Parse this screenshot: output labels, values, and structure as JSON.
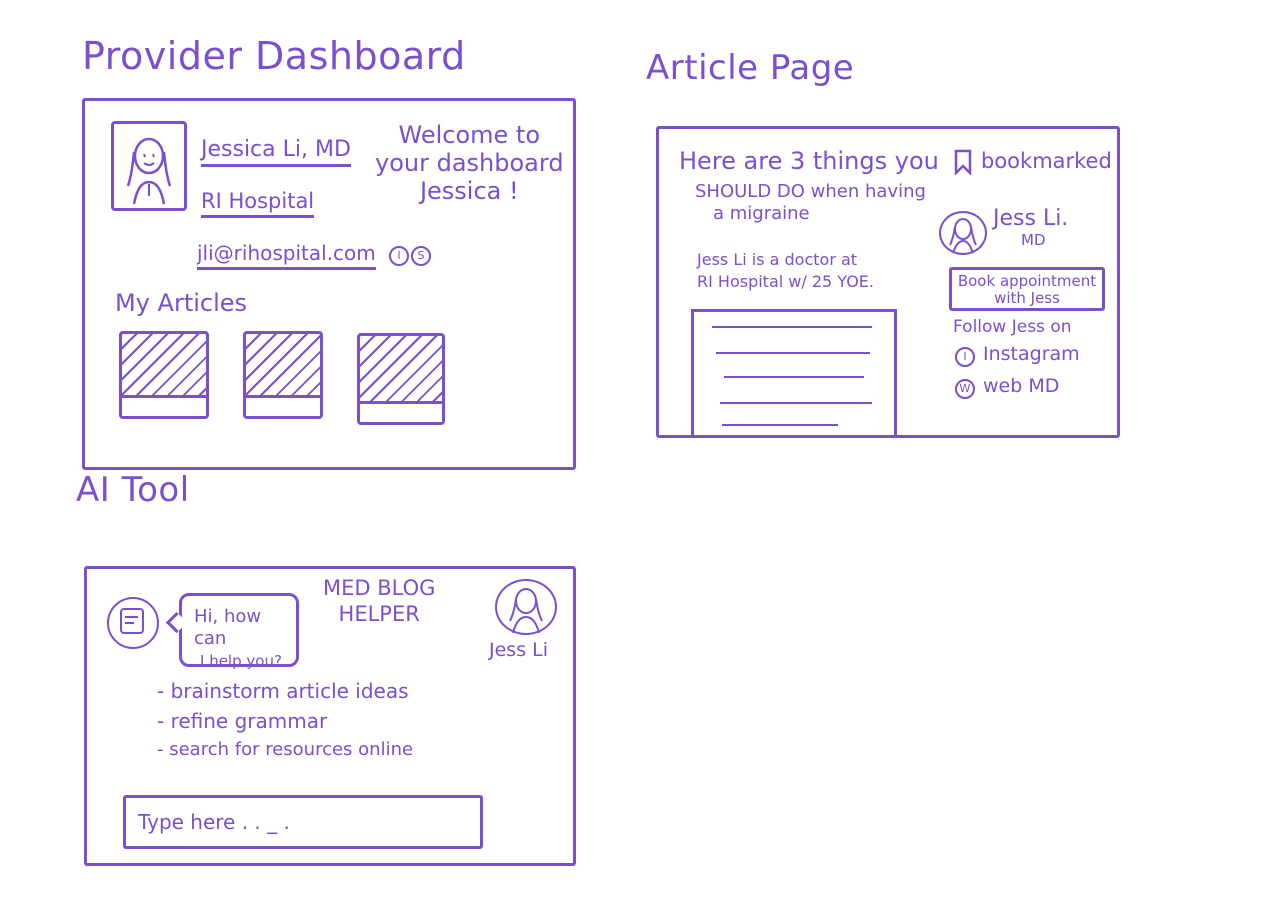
{
  "titles": {
    "provider_dashboard": "Provider Dashboard",
    "article_page": "Article Page",
    "ai_tool": "AI Tool"
  },
  "dashboard": {
    "name": "Jessica Li, MD",
    "hospital": "RI Hospital",
    "email": "jli@rihospital.com",
    "social_icons": [
      "I",
      "S"
    ],
    "welcome_line1": "Welcome to",
    "welcome_line2": "your dashboard",
    "welcome_line3": "Jessica !",
    "articles_heading": "My Articles"
  },
  "article": {
    "headline": "Here are 3 things you",
    "subheadline1": "SHOULD DO when having",
    "subheadline2": "a migraine",
    "bookmark_label": "bookmarked",
    "author_name": "Jess Li.",
    "author_title": "MD",
    "bio_line1": "Jess Li is a doctor at",
    "bio_line2": "RI Hospital w/ 25 YOE.",
    "book_button_line1": "Book appointment",
    "book_button_line2": "with Jess",
    "follow_label": "Follow Jess on",
    "follow_links": [
      {
        "icon": "I",
        "label": "Instagram"
      },
      {
        "icon": "W",
        "label": "web MD"
      }
    ]
  },
  "ai_tool": {
    "title_line1": "MED BLOG",
    "title_line2": "HELPER",
    "user_name": "Jess Li",
    "bubble_line1": "Hi, how can",
    "bubble_line2": "I help you?",
    "options": [
      "- brainstorm article ideas",
      "- refine grammar",
      "- search for resources online"
    ],
    "input_placeholder": "Type here . . _ ."
  }
}
